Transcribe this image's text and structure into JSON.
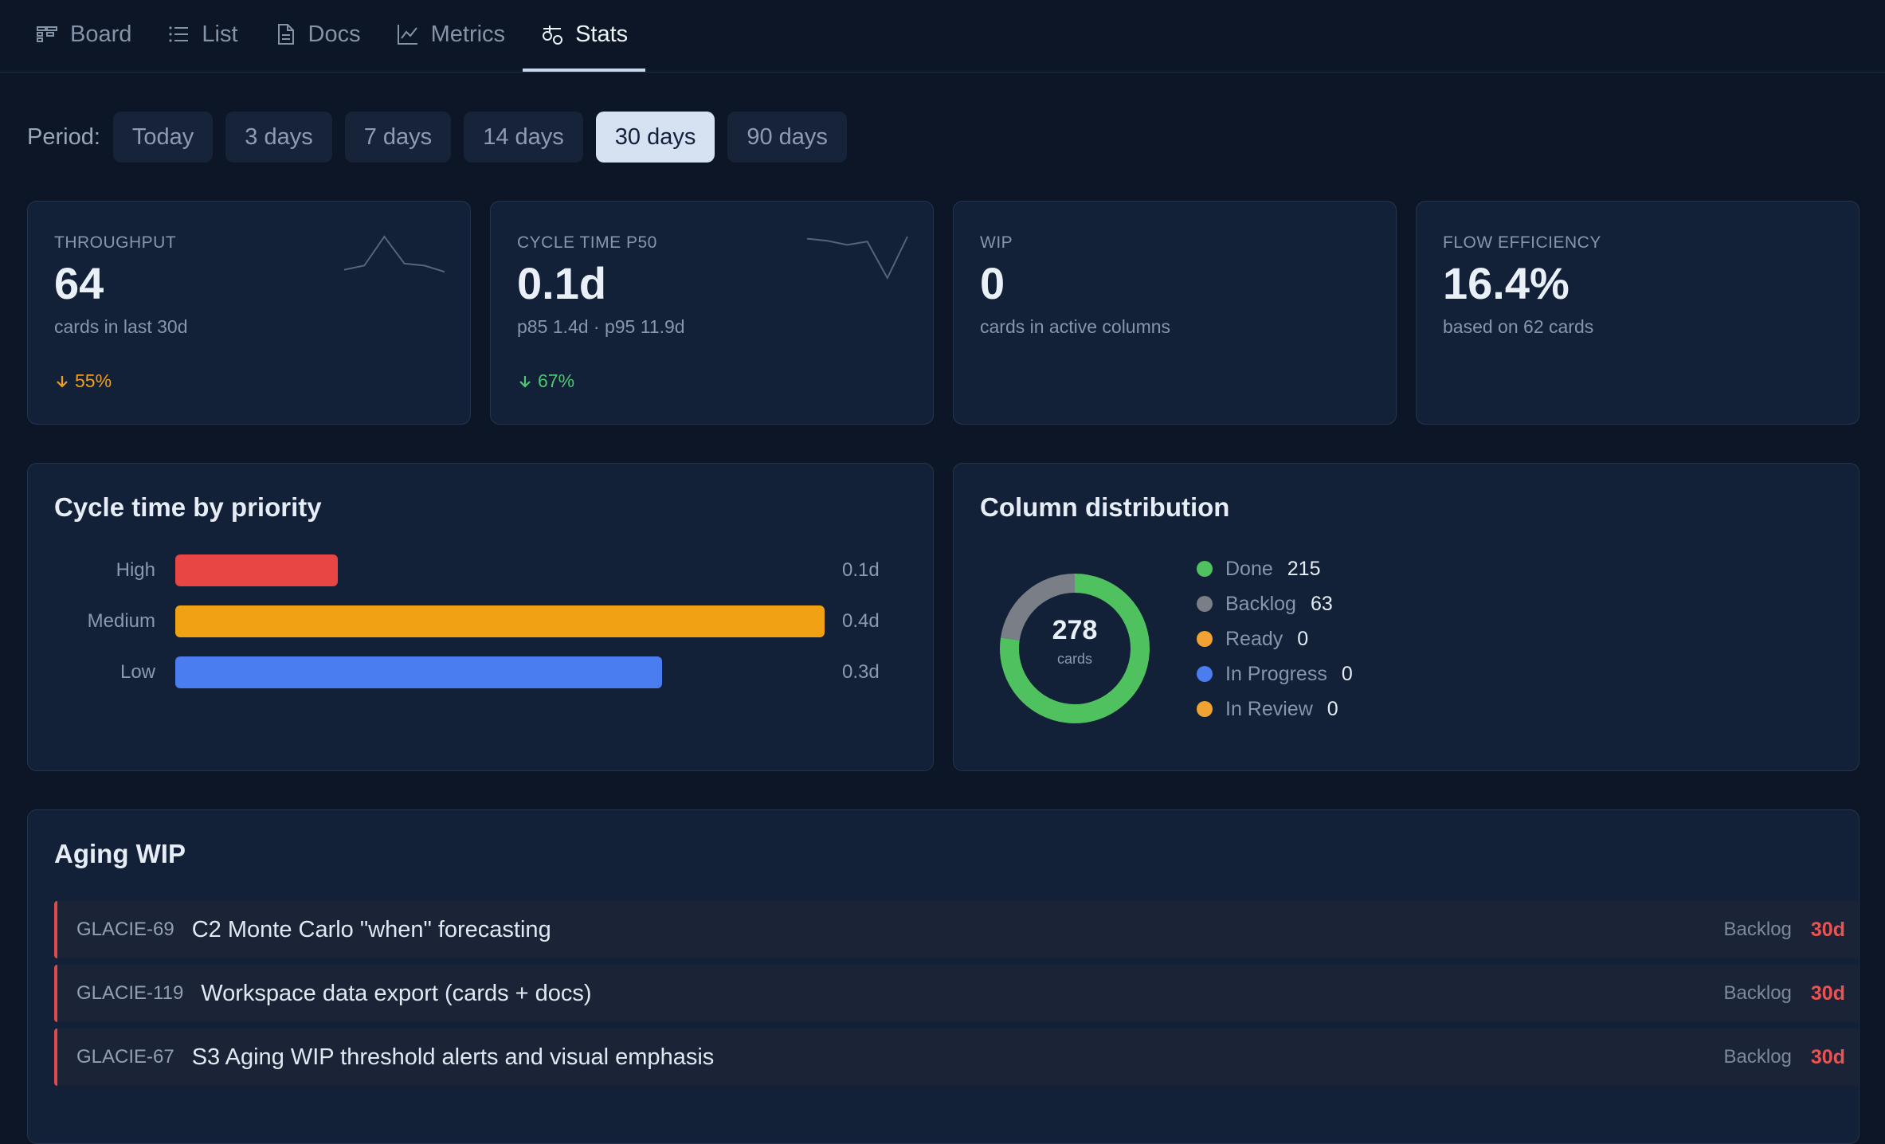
{
  "tabs": [
    {
      "label": "Board",
      "icon": "board-icon",
      "active": false
    },
    {
      "label": "List",
      "icon": "list-icon",
      "active": false
    },
    {
      "label": "Docs",
      "icon": "doc-icon",
      "active": false
    },
    {
      "label": "Metrics",
      "icon": "chart-line-icon",
      "active": false
    },
    {
      "label": "Stats",
      "icon": "stats-icon",
      "active": true
    }
  ],
  "period": {
    "label": "Period:",
    "options": [
      "Today",
      "3 days",
      "7 days",
      "14 days",
      "30 days",
      "90 days"
    ],
    "selected": "30 days"
  },
  "kpis": [
    {
      "label": "THROUGHPUT",
      "value": "64",
      "sub": "cards in last 30d",
      "delta": "55%",
      "delta_direction": "down",
      "delta_color": "#f0a020",
      "sparkline": [
        0.2,
        0.3,
        1.0,
        0.35,
        0.3,
        0.15
      ]
    },
    {
      "label": "CYCLE TIME P50",
      "value": "0.1d",
      "sub": "p85 1.4d · p95 11.9d",
      "delta": "67%",
      "delta_direction": "down",
      "delta_color": "#4cc870",
      "sparkline": [
        0.95,
        0.9,
        0.8,
        0.88,
        0.0,
        1.0
      ]
    },
    {
      "label": "WIP",
      "value": "0",
      "sub": "cards in active columns"
    },
    {
      "label": "FLOW EFFICIENCY",
      "value": "16.4%",
      "sub": "based on 62 cards"
    }
  ],
  "cycle_panel": {
    "title": "Cycle time by priority"
  },
  "column_panel": {
    "title": "Column distribution",
    "center_value": "278",
    "center_label": "cards"
  },
  "aging": {
    "title": "Aging WIP",
    "rows": [
      {
        "id": "GLACIE-69",
        "title": "C2 Monte Carlo \"when\" forecasting",
        "column": "Backlog",
        "age": "30d"
      },
      {
        "id": "GLACIE-119",
        "title": "Workspace data export (cards + docs)",
        "column": "Backlog",
        "age": "30d"
      },
      {
        "id": "GLACIE-67",
        "title": "S3 Aging WIP threshold alerts and visual emphasis",
        "column": "Backlog",
        "age": "30d"
      }
    ]
  },
  "chart_data": [
    {
      "type": "bar",
      "orientation": "horizontal",
      "title": "Cycle time by priority",
      "categories": [
        "High",
        "Medium",
        "Low"
      ],
      "values": [
        0.1,
        0.4,
        0.3
      ],
      "value_labels": [
        "0.1d",
        "0.4d",
        "0.3d"
      ],
      "bar_fractions": [
        0.25,
        1.0,
        0.75
      ],
      "colors": [
        "#e84545",
        "#f0a214",
        "#4a7ef0"
      ]
    },
    {
      "type": "pie",
      "donut": true,
      "title": "Column distribution",
      "total": 278,
      "categories": [
        "Done",
        "Backlog",
        "Ready",
        "In Progress",
        "In Review"
      ],
      "values": [
        215,
        63,
        0,
        0,
        0
      ],
      "colors": [
        "#4fc15e",
        "#7a7f87",
        "#f0a232",
        "#4a7ef0",
        "#f0a232"
      ]
    }
  ]
}
